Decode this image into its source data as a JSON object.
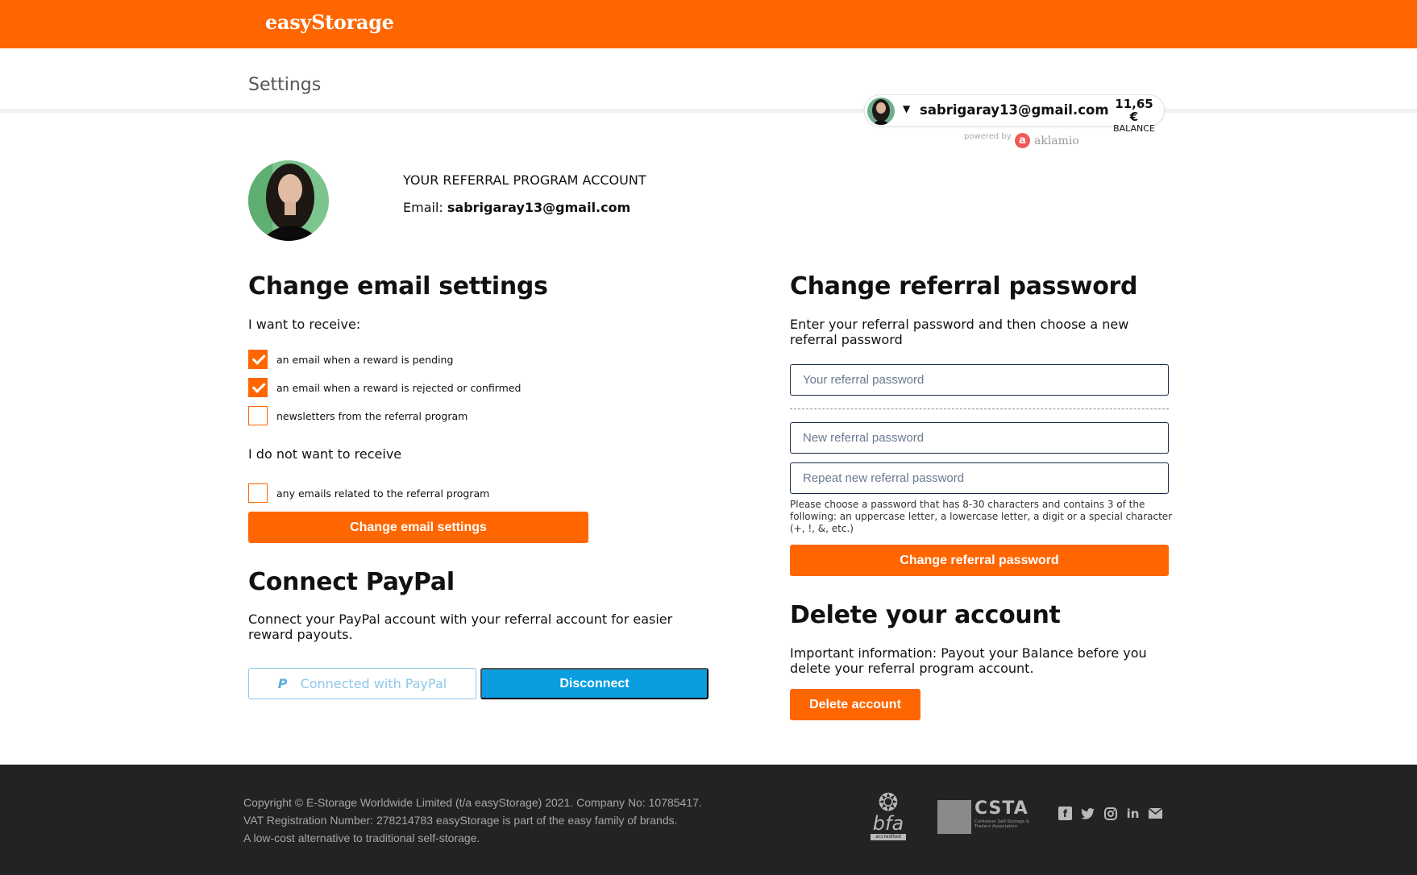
{
  "header": {
    "logo": "easyStorage"
  },
  "page": {
    "title": "Settings"
  },
  "widget": {
    "email": "sabrigaray13@gmail.com",
    "balance_amount": "11,65 €",
    "balance_label": "BALANCE",
    "powered_by": "powered by",
    "brand": "aklamio"
  },
  "profile": {
    "account_title": "YOUR REFERRAL PROGRAM ACCOUNT",
    "email_label": "Email:",
    "email": "sabrigaray13@gmail.com"
  },
  "email_settings": {
    "heading": "Change email settings",
    "receive_label": "I want to receive:",
    "options": [
      {
        "label": "an email when a reward is pending",
        "checked": true
      },
      {
        "label": "an email when a reward is rejected or confirmed",
        "checked": true
      },
      {
        "label": "newsletters from the referral program",
        "checked": false
      }
    ],
    "not_receive_label": "I do not want to receive",
    "opt_out": {
      "label": "any emails related to the referral program",
      "checked": false
    },
    "button": "Change email settings"
  },
  "paypal": {
    "heading": "Connect PayPal",
    "description": "Connect your PayPal account with your referral account for easier reward payouts.",
    "connected_label": "Connected with PayPal",
    "disconnect_label": "Disconnect"
  },
  "password": {
    "heading": "Change referral password",
    "description": "Enter your referral password and then choose a new referral password",
    "current_placeholder": "Your referral password",
    "new_placeholder": "New referral password",
    "repeat_placeholder": "Repeat new referral password",
    "hint": "Please choose a password that has 8-30 characters and contains 3 of the following: an uppercase letter, a lowercase letter, a digit or a special character (+, !, &, etc.)",
    "button": "Change referral password"
  },
  "delete": {
    "heading": "Delete your account",
    "description": "Important information: Payout your Balance before you delete your referral program account.",
    "button": "Delete account"
  },
  "footer": {
    "line1": "Copyright © E-Storage Worldwide Limited (t/a easyStorage) 2021. Company No: 10785417.",
    "line2": "VAT Registration Number: 278214783 easyStorage is part of the easy family of brands.",
    "line3": "A low-cost alternative to traditional self-storage.",
    "bfa_text": "bfa",
    "bfa_sub": "accredited",
    "csta_text": "CSTA",
    "csta_sub": "Container Self-Storage & Traders Association"
  },
  "colors": {
    "brand_orange": "#ff6600",
    "paypal_blue": "#0a9de0",
    "footer_bg": "#232323"
  }
}
